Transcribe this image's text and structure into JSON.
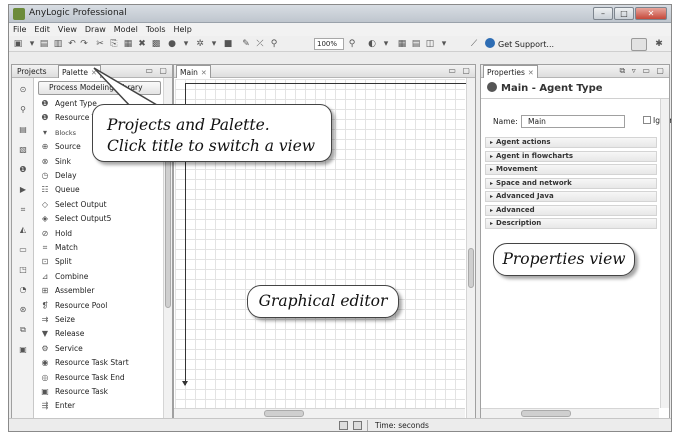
{
  "window": {
    "title": "AnyLogic Professional"
  },
  "menu": [
    "File",
    "Edit",
    "View",
    "Draw",
    "Model",
    "Tools",
    "Help"
  ],
  "toolbar": {
    "zoom": "100%",
    "support_label": "Get Support..."
  },
  "left_panel": {
    "tabs": [
      {
        "label": "Projects"
      },
      {
        "label": "Palette"
      }
    ],
    "palette_header": "Process Modeling Library",
    "items": [
      {
        "label": "Agent Type",
        "icon": "agent-type-icon"
      },
      {
        "label": "Resource Type",
        "icon": "resource-type-icon"
      },
      {
        "label": "Blocks",
        "icon": "section-triangle-icon",
        "section": true
      },
      {
        "label": "Source",
        "icon": "source-icon"
      },
      {
        "label": "Sink",
        "icon": "sink-icon"
      },
      {
        "label": "Delay",
        "icon": "delay-icon"
      },
      {
        "label": "Queue",
        "icon": "queue-icon"
      },
      {
        "label": "Select Output",
        "icon": "select-output-icon"
      },
      {
        "label": "Select Output5",
        "icon": "select-output5-icon"
      },
      {
        "label": "Hold",
        "icon": "hold-icon"
      },
      {
        "label": "Match",
        "icon": "match-icon"
      },
      {
        "label": "Split",
        "icon": "split-icon"
      },
      {
        "label": "Combine",
        "icon": "combine-icon"
      },
      {
        "label": "Assembler",
        "icon": "assembler-icon"
      },
      {
        "label": "Resource Pool",
        "icon": "resource-pool-icon"
      },
      {
        "label": "Seize",
        "icon": "seize-icon"
      },
      {
        "label": "Release",
        "icon": "release-icon"
      },
      {
        "label": "Service",
        "icon": "service-icon"
      },
      {
        "label": "Resource Task Start",
        "icon": "resource-task-start-icon"
      },
      {
        "label": "Resource Task End",
        "icon": "resource-task-end-icon"
      },
      {
        "label": "Resource Task",
        "icon": "resource-task-icon"
      },
      {
        "label": "Enter",
        "icon": "enter-icon"
      }
    ]
  },
  "editor": {
    "tab_label": "Main"
  },
  "properties": {
    "tab_label": "Properties",
    "title": "Main - Agent Type",
    "name_label": "Name:",
    "name_value": "Main",
    "ignore_label": "Ignore",
    "sections": [
      "Agent actions",
      "Agent in flowcharts",
      "Movement",
      "Space and network",
      "Advanced Java",
      "Advanced",
      "Description"
    ]
  },
  "status": {
    "time_label": "Time: seconds"
  },
  "callouts": {
    "projects_palette_line1": "Projects and Palette.",
    "projects_palette_line2": "Click title to switch a view",
    "graphical_editor": "Graphical editor",
    "properties_view": "Properties view"
  }
}
